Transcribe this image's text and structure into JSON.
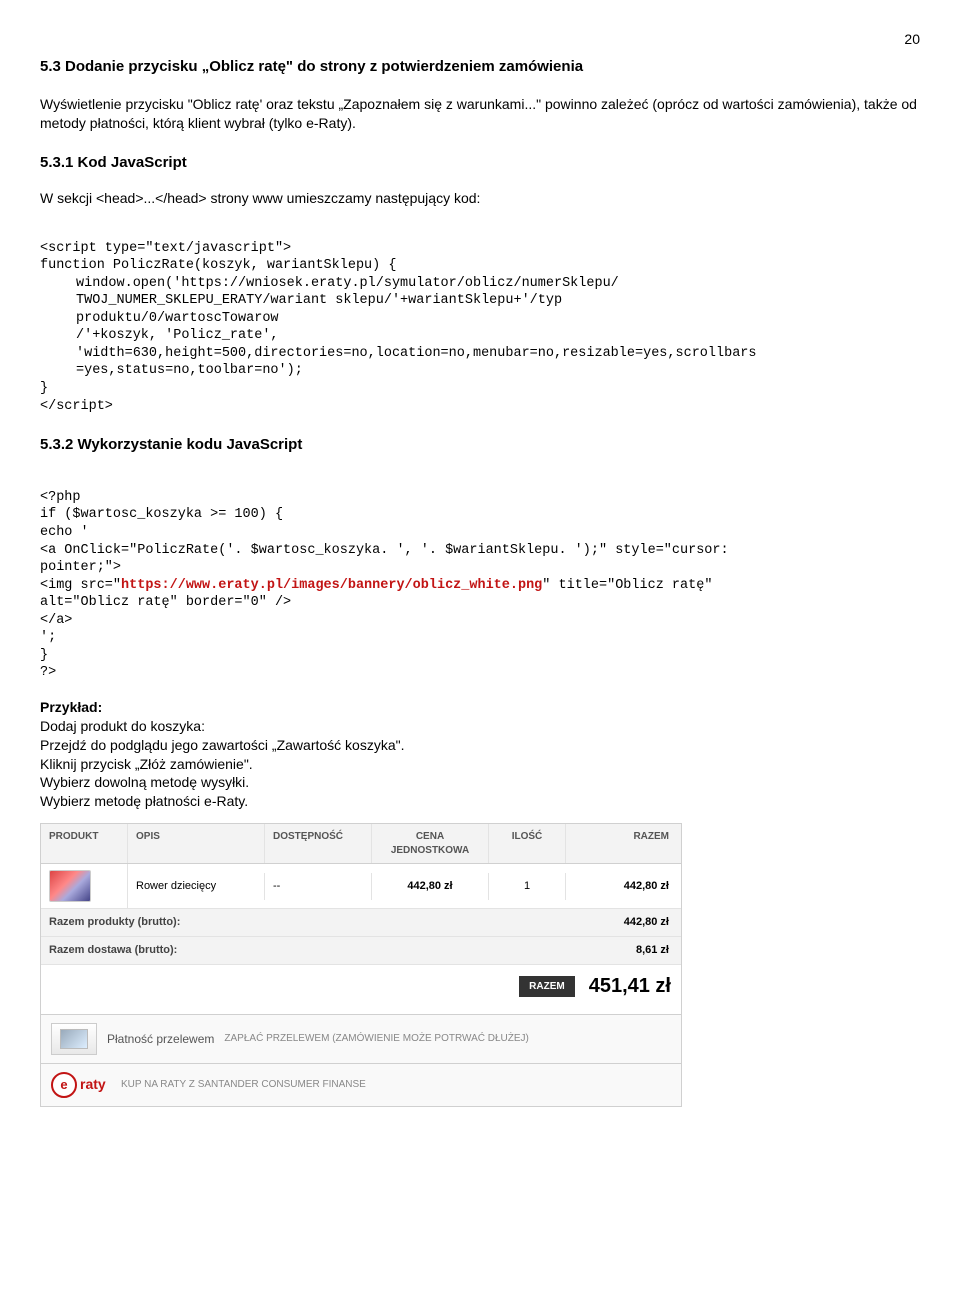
{
  "page_number": "20",
  "section": {
    "h2": "5.3 Dodanie przycisku „Oblicz ratę\" do strony z potwierdzeniem zamówienia",
    "intro": "Wyświetlenie przycisku \"Oblicz ratę' oraz tekstu „Zapoznałem się z warunkami...\" powinno zależeć (oprócz od wartości zamówienia), także od metody płatności, którą klient wybrał (tylko e-Raty).",
    "h3_1": "5.3.1 Kod JavaScript",
    "head_note": "W sekcji <head>...</head> strony www umieszczamy następujący kod:",
    "code1": {
      "l1": "<script type=\"text/javascript\">",
      "l2": "function PoliczRate(koszyk, wariantSklepu) {",
      "l3": "window.open('https://wniosek.eraty.pl/symulator/oblicz/numerSklepu/",
      "l4": "TWOJ_NUMER_SKLEPU_ERATY/wariant sklepu/'+wariantSklepu+'/typ",
      "l5": "produktu/0/wartoscTowarow",
      "l6": "/'+koszyk, 'Policz_rate',",
      "l7": "'width=630,height=500,directories=no,location=no,menubar=no,resizable=yes,scrollbars",
      "l8": "=yes,status=no,toolbar=no');",
      "l9": "}",
      "l10": "</script>"
    },
    "h3_2": "5.3.2 Wykorzystanie kodu JavaScript",
    "code2": {
      "l1": "<?php",
      "l2": "if ($wartosc_koszyka >= 100) {",
      "l3": "echo '",
      "l4": "<a OnClick=\"PoliczRate('. $wartosc_koszyka. ', '. $wariantSklepu. ');\" style=\"cursor:",
      "l5": "pointer;\">",
      "l6a": "<img src=\"",
      "l6b": "https://www.eraty.pl/images/bannery/oblicz_white.png",
      "l6c": "\" title=\"Oblicz ratę\"",
      "l7": "alt=\"Oblicz ratę\" border=\"0\" />",
      "l8": "</a>",
      "l9": "';",
      "l10": "}",
      "l11": "?>"
    },
    "example_label": "Przykład:",
    "ex1": "Dodaj produkt do koszyka:",
    "ex2": "Przejdź do podglądu jego zawartości „Zawartość koszyka\".",
    "ex3": "Kliknij przycisk „Złóż zamówienie\".",
    "ex4": "Wybierz dowolną metodę wysyłki.",
    "ex5": "Wybierz metodę płatności e-Raty."
  },
  "cart": {
    "head": {
      "produkt": "PRODUKT",
      "opis": "OPIS",
      "dostepnosc": "DOSTĘPNOŚĆ",
      "cena": "CENA JEDNOSTKOWA",
      "ilosc": "ILOŚĆ",
      "razem": "RAZEM"
    },
    "row": {
      "opis": "Rower dziecięcy",
      "dost": "--",
      "cena": "442,80 zł",
      "ilosc": "1",
      "razem": "442,80 zł"
    },
    "sum_products_label": "Razem produkty (brutto):",
    "sum_products_val": "442,80 zł",
    "sum_delivery_label": "Razem dostawa (brutto):",
    "sum_delivery_val": "8,61 zł",
    "total_badge": "RAZEM",
    "total": "451,41 zł",
    "pay1_title": "Płatność przelewem",
    "pay1_desc": "ZAPŁAĆ PRZELEWEM (ZAMÓWIENIE MOŻE POTRWAĆ DŁUŻEJ)",
    "pay2_brand": "raty",
    "pay2_desc": "KUP NA RATY Z SANTANDER CONSUMER FINANSE"
  }
}
